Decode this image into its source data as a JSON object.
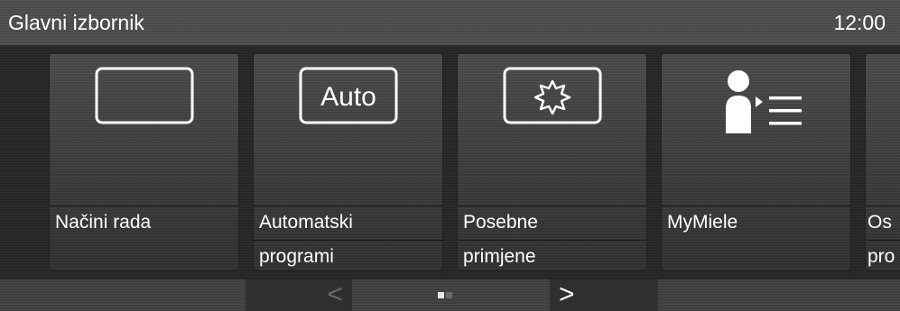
{
  "header": {
    "title": "Glavni izbornik",
    "clock": "12:00"
  },
  "tiles": [
    {
      "lines": [
        "Načini rada"
      ],
      "icon": "blank-screen-icon"
    },
    {
      "lines": [
        "Automatski",
        "programi"
      ],
      "icon": "auto-icon",
      "icon_text": "Auto"
    },
    {
      "lines": [
        "Posebne",
        "primjene"
      ],
      "icon": "special-applications-icon"
    },
    {
      "lines": [
        "MyMiele"
      ],
      "icon": "user-list-icon"
    },
    {
      "lines": [
        "Os",
        "pro"
      ],
      "icon": "partial-tile"
    }
  ],
  "footer": {
    "prev_label": "<",
    "next_label": ">",
    "page_count": 2,
    "current_page": 1
  },
  "colors": {
    "background": "#1a1a1a",
    "header": "#4a4a4a",
    "tile": "#3a3a3a",
    "text": "#ffffff"
  }
}
